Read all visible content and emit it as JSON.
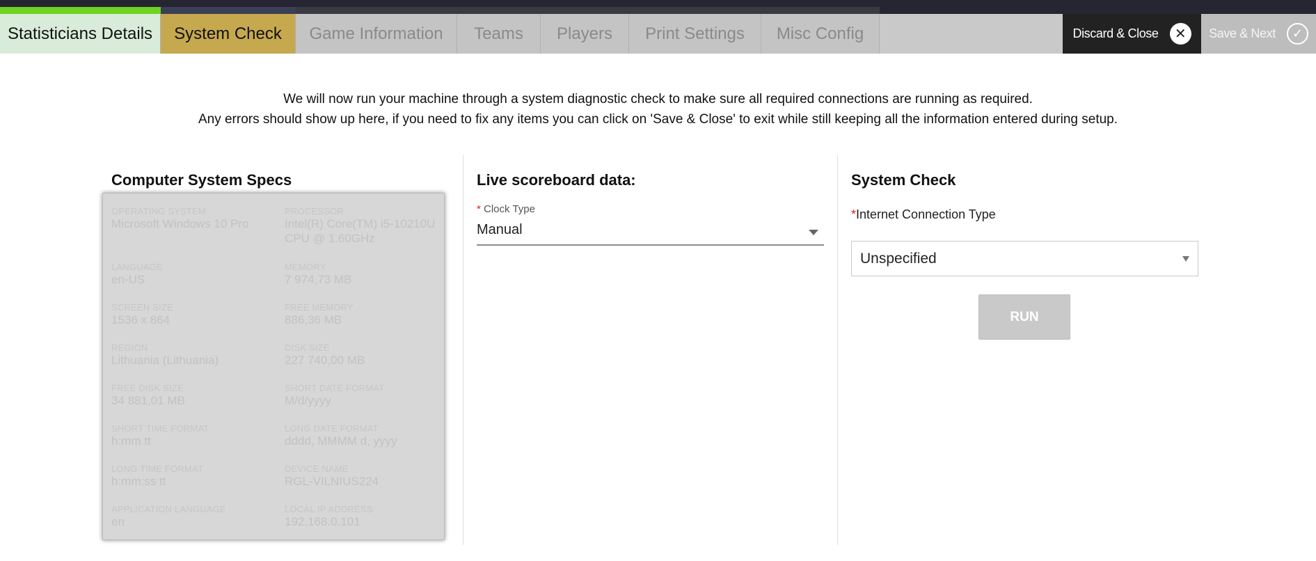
{
  "tabs": [
    {
      "label": "Statisticians Details",
      "state": "done"
    },
    {
      "label": "System Check",
      "state": "active"
    },
    {
      "label": "Game Information",
      "state": "inactive"
    },
    {
      "label": "Teams",
      "state": "inactive"
    },
    {
      "label": "Players",
      "state": "inactive"
    },
    {
      "label": "Print Settings",
      "state": "inactive"
    },
    {
      "label": "Misc Config",
      "state": "inactive"
    }
  ],
  "actions": {
    "discard_label": "Discard & Close",
    "save_label": "Save & Next"
  },
  "intro": {
    "line1": "We will now run your machine through a system diagnostic check to make sure all required connections are running as required.",
    "line2": "Any errors should show up here, if you need to fix any items you can click on 'Save & Close' to exit while still keeping all the information entered during setup."
  },
  "specs": {
    "title": "Computer System Specs",
    "items": [
      {
        "label": "OPERATING SYSTEM",
        "value": "Microsoft Windows 10 Pro"
      },
      {
        "label": "PROCESSOR",
        "value": "Intel(R) Core(TM) i5-10210U CPU @ 1.60GHz"
      },
      {
        "label": "LANGUAGE",
        "value": "en-US"
      },
      {
        "label": "MEMORY",
        "value": "7 974,73 MB"
      },
      {
        "label": "SCREEN SIZE",
        "value": "1536 x 864"
      },
      {
        "label": "FREE MEMORY",
        "value": "886,36 MB"
      },
      {
        "label": "REGION",
        "value": "Lithuania (Lithuania)"
      },
      {
        "label": "DISK SIZE",
        "value": "227 740,00 MB"
      },
      {
        "label": "FREE DISK SIZE",
        "value": "34 881,01 MB"
      },
      {
        "label": "SHORT DATE FORMAT",
        "value": "M/d/yyyy"
      },
      {
        "label": "SHORT TIME FORMAT",
        "value": "h:mm tt"
      },
      {
        "label": "LONG DATE FORMAT",
        "value": "dddd, MMMM d, yyyy"
      },
      {
        "label": "LONG TIME FORMAT",
        "value": "h:mm:ss tt"
      },
      {
        "label": "DEVICE NAME",
        "value": "RGL-VILNIUS224"
      },
      {
        "label": "APPLICATION LANGUAGE",
        "value": "en"
      },
      {
        "label": "LOCAL IP ADDRESS",
        "value": "192.168.0.101"
      }
    ]
  },
  "scoreboard": {
    "title": "Live scoreboard data:",
    "clock_label": "Clock Type",
    "required_mark": "*",
    "clock_value": "Manual"
  },
  "system_check": {
    "title": "System Check",
    "required_mark": "*",
    "connection_label": "Internet Connection Type",
    "connection_value": "Unspecified",
    "run_label": "RUN"
  }
}
